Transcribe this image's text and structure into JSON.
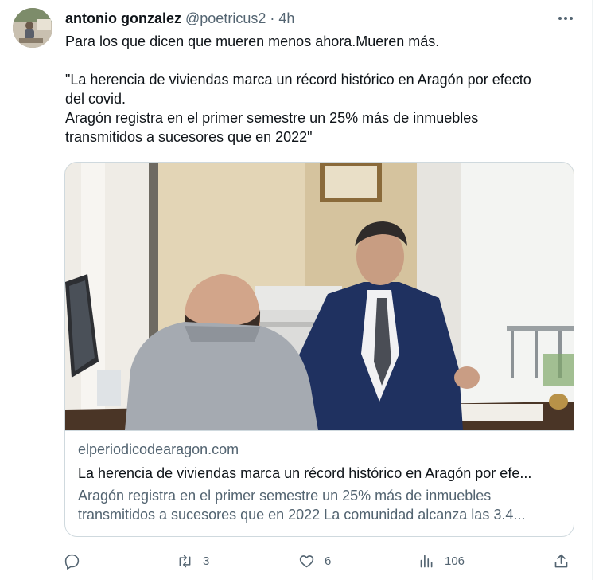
{
  "tweet": {
    "author_name": "antonio gonzalez",
    "author_handle": "@poetricus2",
    "separator": "·",
    "time": "4h",
    "text_lines": [
      "Para los que dicen que mueren menos ahora.Mueren más.",
      "",
      "\"La herencia de viviendas marca un récord histórico en Aragón por efecto",
      "del covid.",
      "Aragón registra en el primer semestre un 25% más de inmuebles",
      "transmitidos a sucesores que en 2022\""
    ]
  },
  "card": {
    "domain": "elperiodicodearagon.com",
    "title": "La herencia de viviendas marca un récord histórico en Aragón por efe...",
    "description_line1": "Aragón registra en el primer semestre un 25% más de inmuebles",
    "description_line2": "transmitidos a sucesores que en 2022 La comunidad alcanza las 3.4..."
  },
  "actions": {
    "reply_count": "",
    "retweet_count": "3",
    "like_count": "6",
    "views_count": "106"
  },
  "icons": {
    "more": "more-icon",
    "reply": "reply-icon",
    "retweet": "retweet-icon",
    "like": "heart-icon",
    "views": "views-icon",
    "share": "share-icon"
  },
  "colors": {
    "text_primary": "#0f1419",
    "text_secondary": "#536471",
    "border": "#cfd9de"
  }
}
